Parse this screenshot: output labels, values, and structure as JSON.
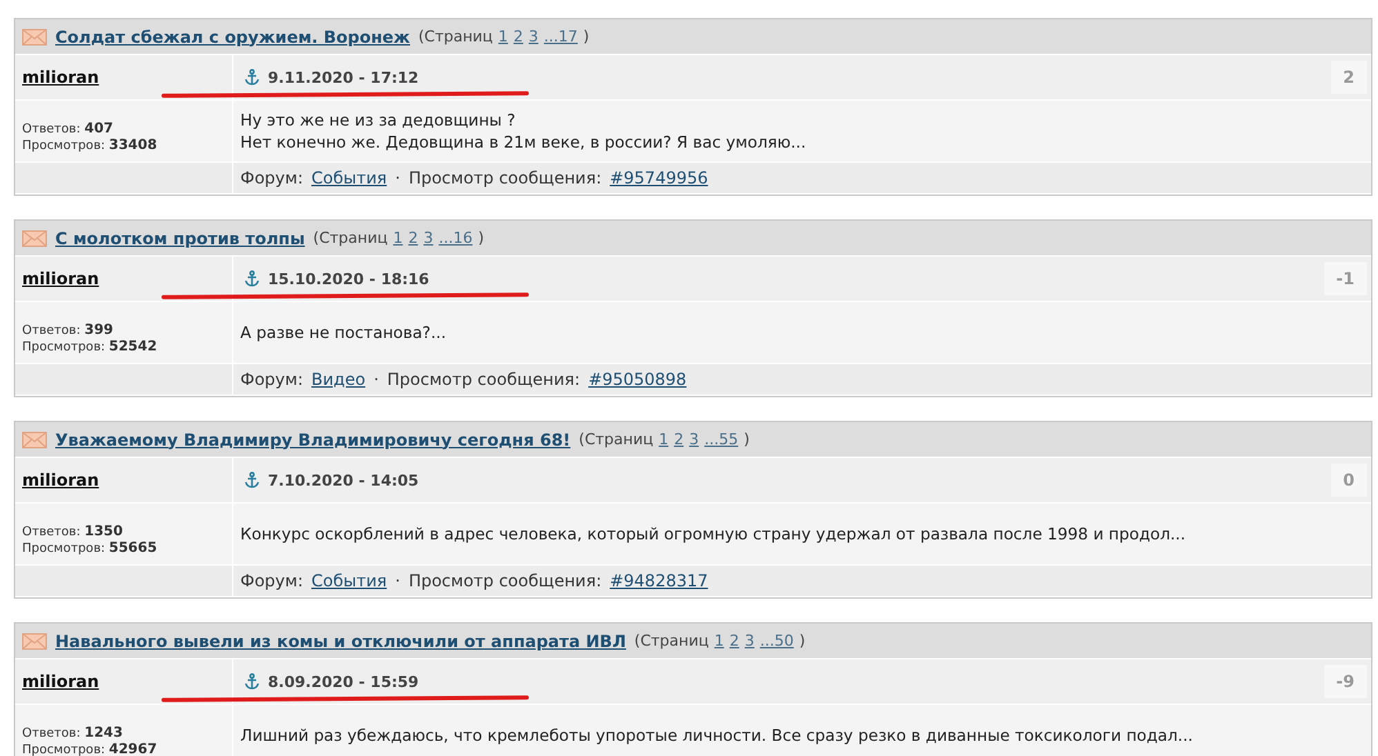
{
  "posts": [
    {
      "title": "Солдат сбежал с оружием. Воронеж",
      "pages_label": "(Страниц",
      "pages": [
        "1",
        "2",
        "3",
        "...17"
      ],
      "pages_close": ")",
      "author": "milioran",
      "date": "9.11.2020 - 17:12",
      "marked": true,
      "score": "2",
      "replies_label": "Ответов:",
      "replies": "407",
      "views_label": "Просмотров:",
      "views": "33408",
      "body": [
        "Ну это же не из за дедовщины ?",
        "Нет конечно же. Дедовщина в 21м веке, в россии? Я вас умоляю..."
      ],
      "forum_label": "Форум:",
      "forum": "События",
      "sep": "·",
      "view_label": "Просмотр сообщения:",
      "post_link": "#95749956"
    },
    {
      "title": "С молотком против толпы",
      "pages_label": "(Страниц",
      "pages": [
        "1",
        "2",
        "3",
        "...16"
      ],
      "pages_close": ")",
      "author": "milioran",
      "date": "15.10.2020 - 18:16",
      "marked": true,
      "score": "-1",
      "replies_label": "Ответов:",
      "replies": "399",
      "views_label": "Просмотров:",
      "views": "52542",
      "body": [
        "А разве не постанова?..."
      ],
      "forum_label": "Форум:",
      "forum": "Видео",
      "sep": "·",
      "view_label": "Просмотр сообщения:",
      "post_link": "#95050898"
    },
    {
      "title": "Уважаемому Владимиру Владимировичу сегодня 68!",
      "pages_label": "(Страниц",
      "pages": [
        "1",
        "2",
        "3",
        "...55"
      ],
      "pages_close": ")",
      "author": "milioran",
      "date": "7.10.2020 - 14:05",
      "marked": false,
      "score": "0",
      "replies_label": "Ответов:",
      "replies": "1350",
      "views_label": "Просмотров:",
      "views": "55665",
      "body": [
        "Конкурс оскорблений в адрес человека, который огромную страну удержал от развала после 1998 и продол..."
      ],
      "forum_label": "Форум:",
      "forum": "События",
      "sep": "·",
      "view_label": "Просмотр сообщения:",
      "post_link": "#94828317"
    },
    {
      "title": "Навального вывели из комы и отключили от аппарата ИВЛ",
      "pages_label": "(Страниц",
      "pages": [
        "1",
        "2",
        "3",
        "...50"
      ],
      "pages_close": ")",
      "author": "milioran",
      "date": "8.09.2020 - 15:59",
      "marked": true,
      "score": "-9",
      "replies_label": "Ответов:",
      "replies": "1243",
      "views_label": "Просмотров:",
      "views": "42967",
      "body": [
        "Лишний раз убеждаюсь, что кремлеботы упоротые личности. Все сразу резко в диванные токсикологи подал..."
      ]
    }
  ]
}
